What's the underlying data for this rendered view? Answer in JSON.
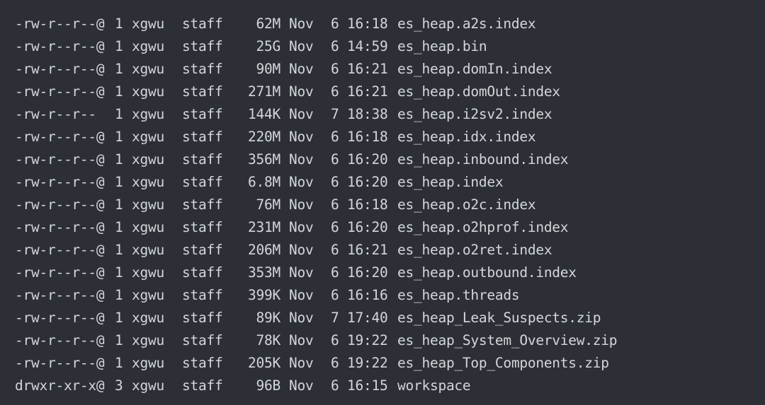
{
  "listing": {
    "rows": [
      {
        "perm": "-rw-r--r--@",
        "links": "1",
        "owner": "xgwu",
        "group": "staff",
        "size": "62M",
        "month": "Nov",
        "day": "6",
        "time": "16:18",
        "name": "es_heap.a2s.index"
      },
      {
        "perm": "-rw-r--r--@",
        "links": "1",
        "owner": "xgwu",
        "group": "staff",
        "size": "25G",
        "month": "Nov",
        "day": "6",
        "time": "14:59",
        "name": "es_heap.bin"
      },
      {
        "perm": "-rw-r--r--@",
        "links": "1",
        "owner": "xgwu",
        "group": "staff",
        "size": "90M",
        "month": "Nov",
        "day": "6",
        "time": "16:21",
        "name": "es_heap.domIn.index"
      },
      {
        "perm": "-rw-r--r--@",
        "links": "1",
        "owner": "xgwu",
        "group": "staff",
        "size": "271M",
        "month": "Nov",
        "day": "6",
        "time": "16:21",
        "name": "es_heap.domOut.index"
      },
      {
        "perm": "-rw-r--r--",
        "links": "1",
        "owner": "xgwu",
        "group": "staff",
        "size": "144K",
        "month": "Nov",
        "day": "7",
        "time": "18:38",
        "name": "es_heap.i2sv2.index"
      },
      {
        "perm": "-rw-r--r--@",
        "links": "1",
        "owner": "xgwu",
        "group": "staff",
        "size": "220M",
        "month": "Nov",
        "day": "6",
        "time": "16:18",
        "name": "es_heap.idx.index"
      },
      {
        "perm": "-rw-r--r--@",
        "links": "1",
        "owner": "xgwu",
        "group": "staff",
        "size": "356M",
        "month": "Nov",
        "day": "6",
        "time": "16:20",
        "name": "es_heap.inbound.index"
      },
      {
        "perm": "-rw-r--r--@",
        "links": "1",
        "owner": "xgwu",
        "group": "staff",
        "size": "6.8M",
        "month": "Nov",
        "day": "6",
        "time": "16:20",
        "name": "es_heap.index"
      },
      {
        "perm": "-rw-r--r--@",
        "links": "1",
        "owner": "xgwu",
        "group": "staff",
        "size": "76M",
        "month": "Nov",
        "day": "6",
        "time": "16:18",
        "name": "es_heap.o2c.index"
      },
      {
        "perm": "-rw-r--r--@",
        "links": "1",
        "owner": "xgwu",
        "group": "staff",
        "size": "231M",
        "month": "Nov",
        "day": "6",
        "time": "16:20",
        "name": "es_heap.o2hprof.index"
      },
      {
        "perm": "-rw-r--r--@",
        "links": "1",
        "owner": "xgwu",
        "group": "staff",
        "size": "206M",
        "month": "Nov",
        "day": "6",
        "time": "16:21",
        "name": "es_heap.o2ret.index"
      },
      {
        "perm": "-rw-r--r--@",
        "links": "1",
        "owner": "xgwu",
        "group": "staff",
        "size": "353M",
        "month": "Nov",
        "day": "6",
        "time": "16:20",
        "name": "es_heap.outbound.index"
      },
      {
        "perm": "-rw-r--r--@",
        "links": "1",
        "owner": "xgwu",
        "group": "staff",
        "size": "399K",
        "month": "Nov",
        "day": "6",
        "time": "16:16",
        "name": "es_heap.threads"
      },
      {
        "perm": "-rw-r--r--@",
        "links": "1",
        "owner": "xgwu",
        "group": "staff",
        "size": "89K",
        "month": "Nov",
        "day": "7",
        "time": "17:40",
        "name": "es_heap_Leak_Suspects.zip"
      },
      {
        "perm": "-rw-r--r--@",
        "links": "1",
        "owner": "xgwu",
        "group": "staff",
        "size": "78K",
        "month": "Nov",
        "day": "6",
        "time": "19:22",
        "name": "es_heap_System_Overview.zip"
      },
      {
        "perm": "-rw-r--r--@",
        "links": "1",
        "owner": "xgwu",
        "group": "staff",
        "size": "205K",
        "month": "Nov",
        "day": "6",
        "time": "19:22",
        "name": "es_heap_Top_Components.zip"
      },
      {
        "perm": "drwxr-xr-x@",
        "links": "3",
        "owner": "xgwu",
        "group": "staff",
        "size": "96B",
        "month": "Nov",
        "day": "6",
        "time": "16:15",
        "name": "workspace"
      }
    ]
  },
  "colors": {
    "background": "#2c3036",
    "text": "#d3d6da"
  }
}
